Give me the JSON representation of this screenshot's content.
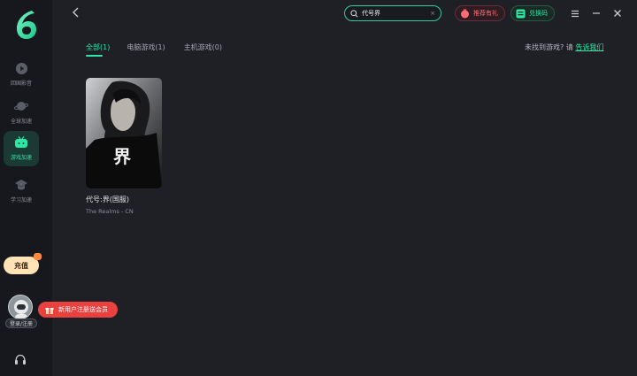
{
  "sidebar": {
    "items": [
      {
        "label": "回国影音",
        "icon": "play-circle-icon"
      },
      {
        "label": "全球加速",
        "icon": "planet-icon"
      },
      {
        "label": "游戏加速",
        "icon": "gamepad-icon"
      },
      {
        "label": "学习加速",
        "icon": "graduation-cap-icon"
      }
    ],
    "recharge_label": "充值",
    "login_label": "登录/注册",
    "promo_label": "新用户注册送会员"
  },
  "topbar": {
    "search_value": "代号界",
    "recommend_label": "推荐有礼",
    "redeem_label": "兑换码"
  },
  "tabs": [
    {
      "label": "全部(1)",
      "active": true
    },
    {
      "label": "电脑游戏(1)",
      "active": false
    },
    {
      "label": "主机游戏(0)",
      "active": false
    }
  ],
  "notfound": {
    "text": "未找到游戏? 请",
    "link": "告诉我们"
  },
  "games": [
    {
      "title": "代号:界(国服)",
      "subtitle": "The Realms - CN",
      "cover_glyph": "界"
    }
  ],
  "colors": {
    "accent": "#2ee6a6",
    "background": "#1f2026",
    "sidebar": "#17181d",
    "danger": "#e8413e"
  }
}
